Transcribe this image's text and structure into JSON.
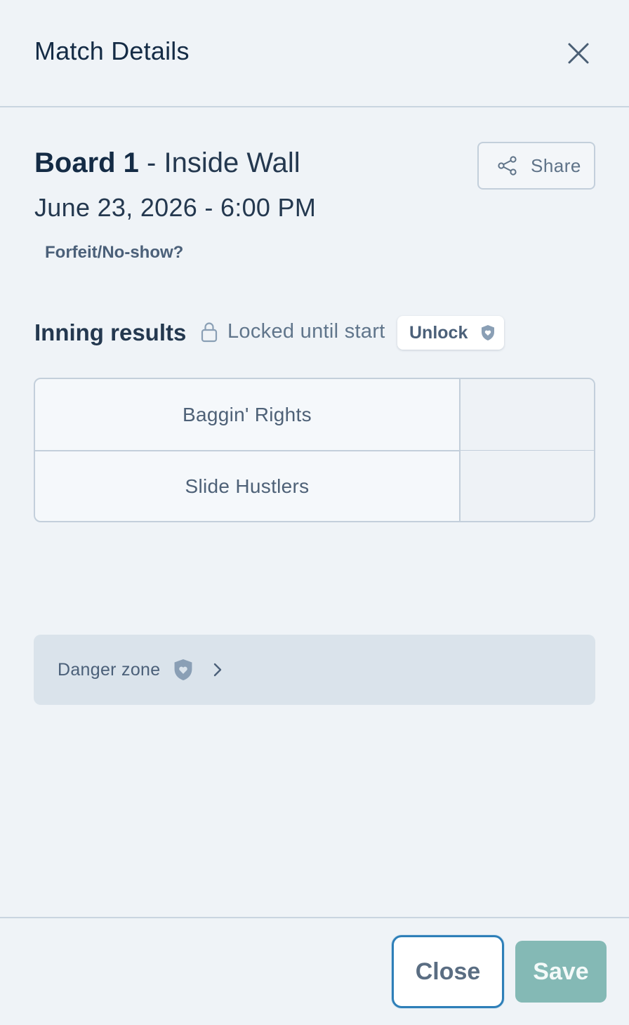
{
  "header": {
    "title": "Match Details"
  },
  "match": {
    "board": "Board 1",
    "location": " - Inside Wall",
    "datetime": "June 23, 2026 - 6:00 PM",
    "forfeit_link": "Forfeit/No-show?"
  },
  "share": {
    "label": "Share"
  },
  "innings": {
    "title": "Inning results",
    "lock_status": "Locked until start",
    "unlock_label": "Unlock",
    "teams": [
      {
        "name": "Baggin' Rights",
        "score": ""
      },
      {
        "name": "Slide Hustlers",
        "score": ""
      }
    ]
  },
  "danger_zone": {
    "label": "Danger zone"
  },
  "footer": {
    "close_label": "Close",
    "save_label": "Save"
  },
  "colors": {
    "background": "#eff3f7",
    "accent_focus": "#2e7fb8",
    "save_disabled": "#84b9b5",
    "icon_muted": "#8a9fb5"
  },
  "icons": {
    "close": "close-icon",
    "share": "share-icon",
    "lock": "lock-icon",
    "shield": "shield-heart-icon",
    "chevron": "chevron-right-icon"
  }
}
